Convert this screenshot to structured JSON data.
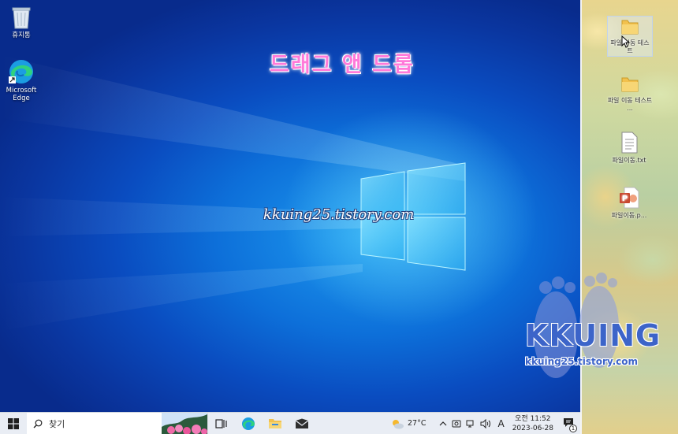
{
  "desktop": {
    "icons": [
      {
        "label": "휴지통",
        "icon": "recycle-bin-icon"
      },
      {
        "label": "Microsoft Edge",
        "icon": "edge-icon"
      }
    ],
    "overlay_title": "드래그 앤 드롭",
    "watermark_url": "kkuing25.tistory.com"
  },
  "right_desktop": {
    "icons": [
      {
        "label": "파일 이동 테스트",
        "icon": "folder-icon"
      },
      {
        "label": "파일 이동 테스트 ...",
        "icon": "folder-icon"
      },
      {
        "label": "파일이동.txt",
        "icon": "text-file-icon"
      },
      {
        "label": "파일이동.p...",
        "icon": "powerpoint-file-icon"
      }
    ]
  },
  "branding": {
    "name": "KKUING",
    "url": "kkuing25.tistory.com"
  },
  "taskbar": {
    "search_placeholder": "찾기",
    "apps": [
      "task-view-icon",
      "edge-icon",
      "file-explorer-icon",
      "mail-icon"
    ],
    "weather": "27°C",
    "ime": "A",
    "clock": {
      "period_time": "오전 11:52",
      "date": "2023-06-28"
    },
    "notification_count": "1"
  },
  "colors": {
    "desktop_accent": "#0d6fd9",
    "taskbar_bg": "#e9edf4",
    "title_pink": "#ff7ad9",
    "brand_blue": "#3c64c9"
  }
}
